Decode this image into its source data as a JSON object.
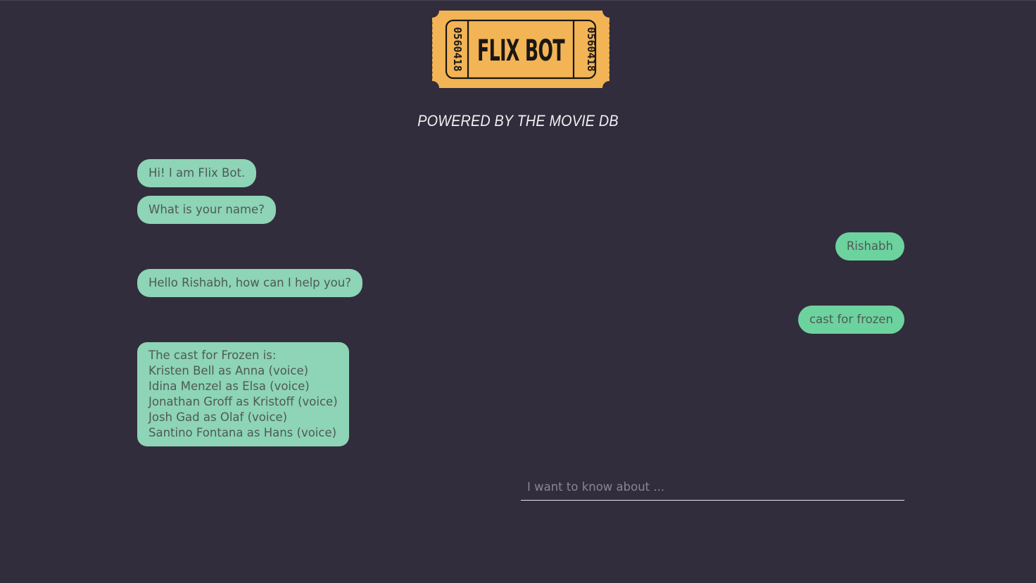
{
  "logo": {
    "title": "FLIX BOT",
    "serial_left": "0560418",
    "serial_right": "0560418",
    "ticket_color": "#f2b455",
    "ink_color": "#1a1715"
  },
  "tagline": "POWERED BY THE MOVIE DB",
  "messages": [
    {
      "sender": "bot",
      "lines": [
        "Hi! I am Flix Bot."
      ]
    },
    {
      "sender": "bot",
      "lines": [
        "What is your name?"
      ]
    },
    {
      "sender": "user",
      "lines": [
        "Rishabh"
      ]
    },
    {
      "sender": "bot",
      "lines": [
        "Hello Rishabh, how can I help you?"
      ]
    },
    {
      "sender": "user",
      "lines": [
        "cast for frozen"
      ]
    },
    {
      "sender": "bot",
      "lines": [
        "The cast for Frozen is:",
        "Kristen Bell as Anna (voice)",
        "Idina Menzel as Elsa (voice)",
        "Jonathan Groff as Kristoff (voice)",
        "Josh Gad as Olaf (voice)",
        "Santino Fontana as Hans (voice)"
      ]
    }
  ],
  "input": {
    "placeholder": "I want to know about ...",
    "value": ""
  },
  "colors": {
    "background": "#322d3c",
    "bot_bubble": "#8ed4b6",
    "user_bubble": "#6cd39e",
    "bubble_text": "#4e5a56"
  }
}
